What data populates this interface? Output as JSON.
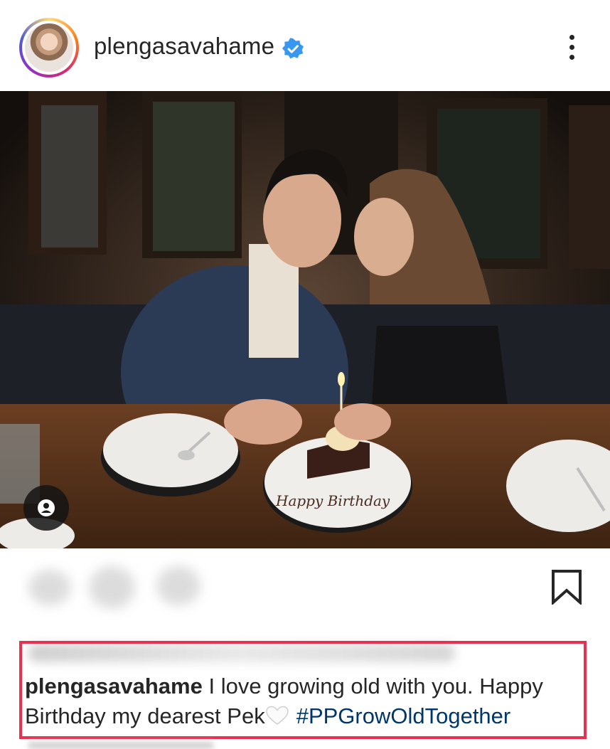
{
  "post": {
    "username": "plengasavahame",
    "verified": true,
    "icons": {
      "verified": "verified-badge-icon",
      "more": "more-options-icon",
      "tag": "user-tag-icon",
      "save": "bookmark-icon",
      "heart": "white-heart-emoji"
    },
    "photo_alt": "Couple at dinner table with birthday cake plate",
    "plate_text": "Happy Birthday"
  },
  "caption": {
    "username": "plengasavahame",
    "text": " I love growing old with you. Happy Birthday my dearest Pek",
    "hashtag": "#PPGrowOldTogether"
  },
  "colors": {
    "highlight_border": "#e8304f",
    "hashtag": "#00376b",
    "verified": "#3897f0"
  }
}
